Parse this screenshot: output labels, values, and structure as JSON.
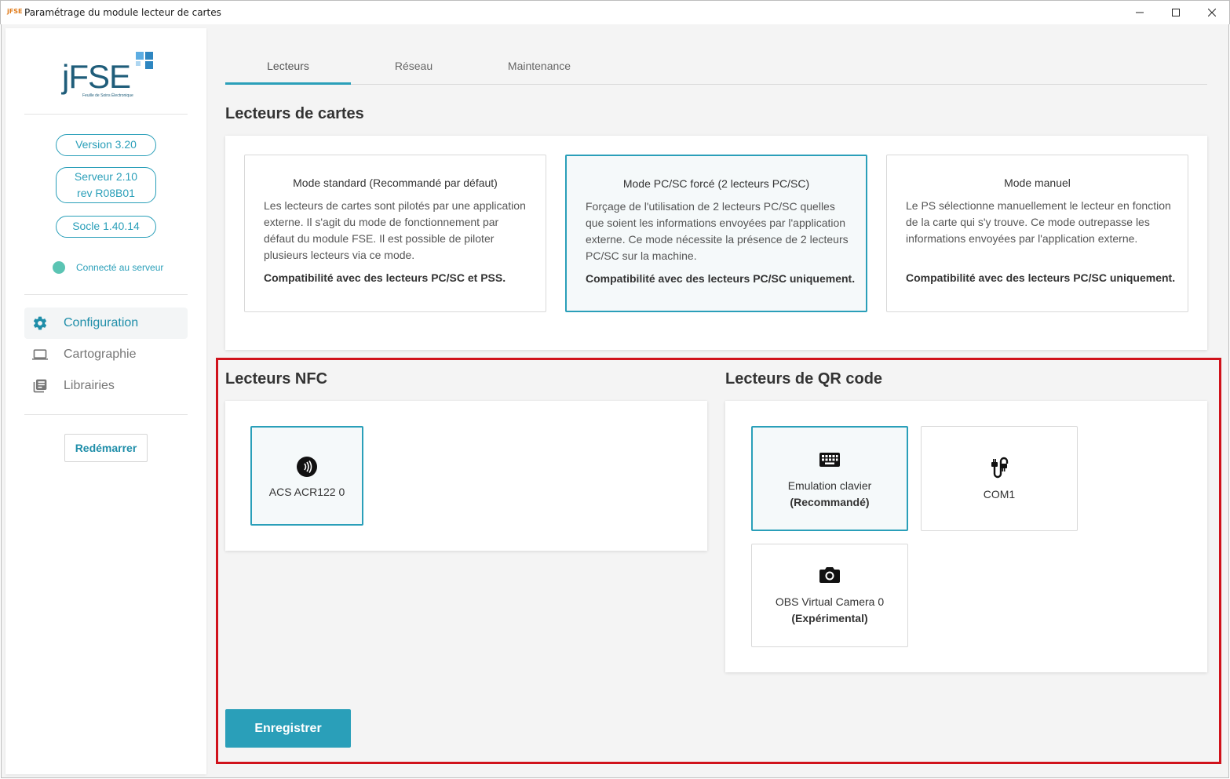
{
  "window": {
    "icon_text": "jFSE",
    "title": "Paramétrage du module lecteur de cartes"
  },
  "sidebar": {
    "logo": {
      "text": "jFSE",
      "subtitle": "Feuille de Soins Électronique",
      "colors": [
        "#1f5d7a",
        "#2e86c1",
        "#5dade2"
      ]
    },
    "version": "Version 3.20",
    "server_line1": "Serveur 2.10",
    "server_line2": "rev R08B01",
    "socle": "Socle 1.40.14",
    "connection_status": "Connecté au serveur",
    "status_color": "#5bc4b3",
    "nav": [
      {
        "label": "Configuration",
        "icon": "gear-icon",
        "active": true
      },
      {
        "label": "Cartographie",
        "icon": "laptop-icon",
        "active": false
      },
      {
        "label": "Librairies",
        "icon": "library-icon",
        "active": false
      }
    ],
    "restart_label": "Redémarrer"
  },
  "tabs": [
    {
      "label": "Lecteurs",
      "active": true
    },
    {
      "label": "Réseau",
      "active": false
    },
    {
      "label": "Maintenance",
      "active": false
    }
  ],
  "card_readers": {
    "title": "Lecteurs de cartes",
    "modes": [
      {
        "title": "Mode standard (Recommandé par défaut)",
        "description": "Les lecteurs de cartes sont pilotés par une application externe. Il s'agit du mode de fonctionnement par défaut du module FSE. Il est possible de piloter plusieurs lecteurs via ce mode.",
        "compat": "Compatibilité avec des lecteurs PC/SC et PSS.",
        "selected": false
      },
      {
        "title": "Mode PC/SC forcé (2 lecteurs PC/SC)",
        "description": "Forçage de l'utilisation de 2 lecteurs PC/SC quelles que soient les informations envoyées par l'application externe. Ce mode nécessite la présence de 2 lecteurs PC/SC sur la machine.",
        "compat": "Compatibilité avec des lecteurs PC/SC uniquement.",
        "selected": true
      },
      {
        "title": "Mode manuel",
        "description": "Le PS sélectionne manuellement le lecteur en fonction de la carte qui s'y trouve. Ce mode outrepasse les informations envoyées par l'application externe.",
        "compat": "Compatibilité avec des lecteurs PC/SC uniquement.",
        "selected": false
      }
    ]
  },
  "nfc": {
    "title": "Lecteurs NFC",
    "devices": [
      {
        "label": "ACS ACR122 0",
        "icon": "nfc-icon",
        "selected": true
      }
    ]
  },
  "qr": {
    "title": "Lecteurs de QR code",
    "devices": [
      {
        "label": "Emulation clavier",
        "sublabel": "(Recommandé)",
        "icon": "keyboard-icon",
        "selected": true
      },
      {
        "label": "COM1",
        "sublabel": "",
        "icon": "serial-cable-icon",
        "selected": false
      },
      {
        "label": "OBS Virtual Camera 0",
        "sublabel": "(Expérimental)",
        "icon": "camera-icon",
        "selected": false
      }
    ]
  },
  "save_label": "Enregistrer",
  "colors": {
    "accent": "#2a9fb9",
    "highlight": "#d0121b"
  }
}
